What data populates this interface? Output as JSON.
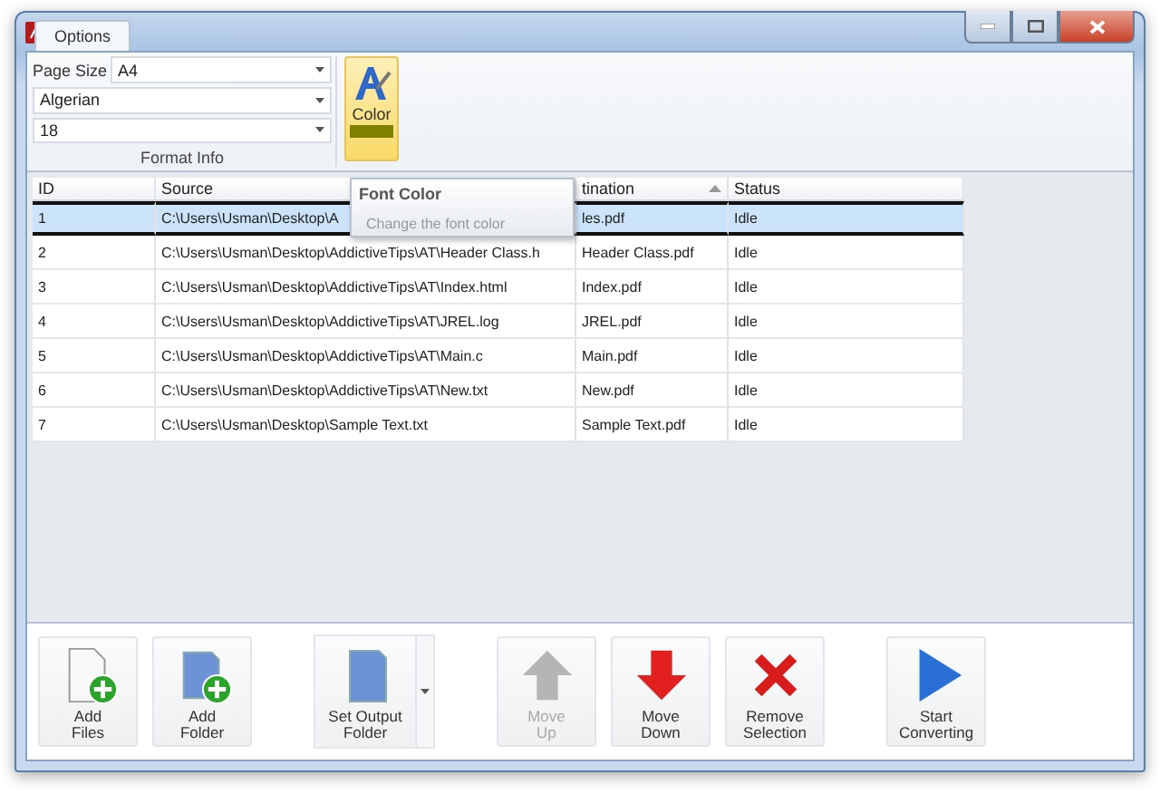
{
  "ribbon": {
    "tabs": [
      {
        "label": "Options",
        "selected": true
      }
    ],
    "page_size": {
      "label": "Page Size",
      "value": "A4"
    },
    "font": {
      "value": "Algerian"
    },
    "font_size": {
      "value": "18"
    },
    "group_label": "Format Info",
    "color_button": {
      "label": "Color",
      "hovered": true,
      "color": "#7f7f00"
    }
  },
  "tooltip": {
    "title": "Font Color",
    "text": "Change the font color"
  },
  "table": {
    "columns": [
      {
        "label": "ID"
      },
      {
        "label": "Source"
      },
      {
        "label": "tination",
        "sorted": true
      },
      {
        "label": "Status"
      }
    ],
    "rows": [
      {
        "selected": true,
        "cells": [
          "1",
          "C:\\Users\\Usman\\Desktop\\A",
          "les.pdf",
          "Idle"
        ]
      },
      {
        "selected": false,
        "cells": [
          "2",
          "C:\\Users\\Usman\\Desktop\\AddictiveTips\\AT\\Header Class.h",
          "Header Class.pdf",
          "Idle"
        ]
      },
      {
        "selected": false,
        "cells": [
          "3",
          "C:\\Users\\Usman\\Desktop\\AddictiveTips\\AT\\Index.html",
          "Index.pdf",
          "Idle"
        ]
      },
      {
        "selected": false,
        "cells": [
          "4",
          "C:\\Users\\Usman\\Desktop\\AddictiveTips\\AT\\JREL.log",
          "JREL.pdf",
          "Idle"
        ]
      },
      {
        "selected": false,
        "cells": [
          "5",
          "C:\\Users\\Usman\\Desktop\\AddictiveTips\\AT\\Main.c",
          "Main.pdf",
          "Idle"
        ]
      },
      {
        "selected": false,
        "cells": [
          "6",
          "C:\\Users\\Usman\\Desktop\\AddictiveTips\\AT\\New.txt",
          "New.pdf",
          "Idle"
        ]
      },
      {
        "selected": false,
        "cells": [
          "7",
          "C:\\Users\\Usman\\Desktop\\Sample Text.txt",
          "Sample Text.pdf",
          "Idle"
        ]
      }
    ]
  },
  "toolbar": {
    "groups": [
      [
        {
          "kind": "file-add",
          "label": "Add\nFiles",
          "disabled": false
        },
        {
          "kind": "folder-add",
          "label": "Add\nFolder",
          "disabled": false
        }
      ],
      [
        {
          "kind": "folder",
          "label": "Set Output\nFolder",
          "disabled": false,
          "dropdown": true
        }
      ],
      [
        {
          "kind": "up",
          "label": "Move\nUp",
          "disabled": true
        },
        {
          "kind": "down",
          "label": "Move\nDown",
          "disabled": false
        },
        {
          "kind": "remove",
          "label": "Remove\nSelection",
          "disabled": false
        }
      ],
      [
        {
          "kind": "play",
          "label": "Start\nConverting",
          "disabled": false
        }
      ]
    ]
  }
}
